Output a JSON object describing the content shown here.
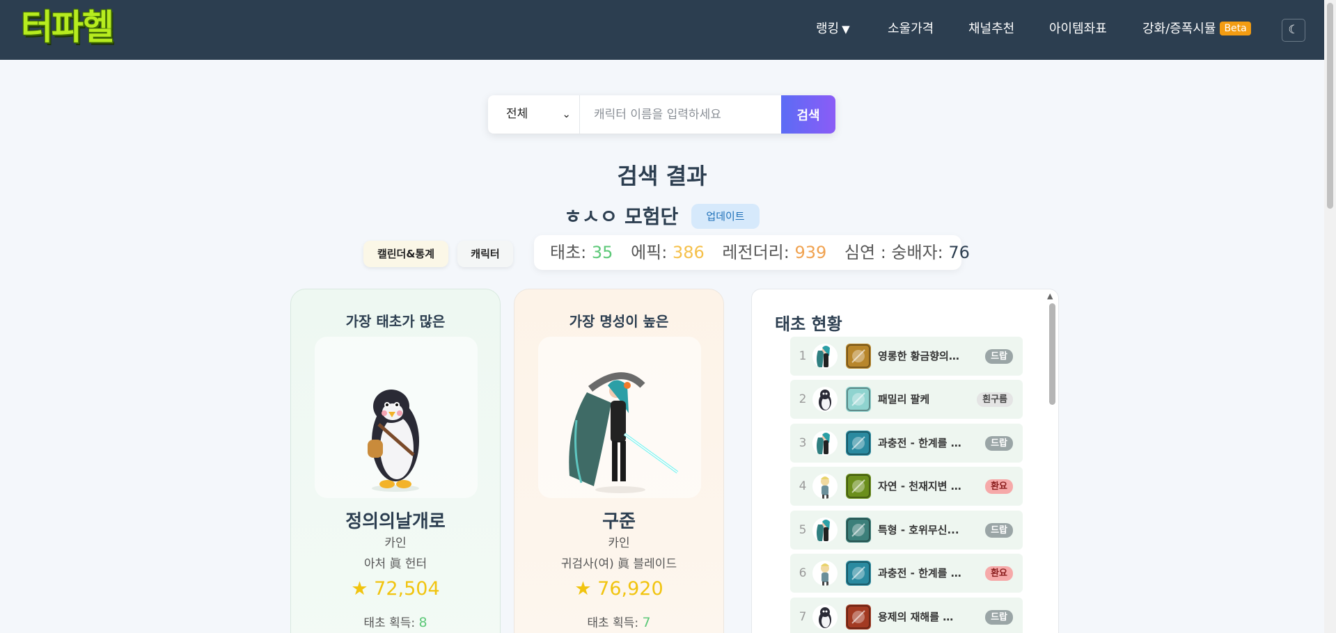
{
  "header": {
    "logo_text": "터파헬",
    "nav": [
      {
        "label": "랭킹",
        "has_caret": true
      },
      {
        "label": "소울가격"
      },
      {
        "label": "채널추천"
      },
      {
        "label": "아이템좌표"
      },
      {
        "label": "강화/증폭시뮬",
        "badge": "Beta"
      }
    ],
    "caret_icon": "▼",
    "theme_toggle_icon": "☾"
  },
  "search": {
    "select_value": "전체",
    "placeholder": "캐릭터 이름을 입력하세요",
    "button_label": "검색"
  },
  "results": {
    "title": "검색 결과",
    "guild_name": "ㅎㅅㅇ 모험단",
    "update_label": "업데이트",
    "tabs": [
      "캘린더&통계",
      "캐릭터"
    ],
    "stats": {
      "taecho_label": "태초:",
      "taecho_value": "35",
      "epic_label": "에픽:",
      "epic_value": "386",
      "legendary_label": "레전더리:",
      "legendary_value": "939",
      "abyss_label": "심연 : 숭배자:",
      "abyss_value": "76"
    }
  },
  "cards": [
    {
      "title": "가장 태초가 많은",
      "name": "정의의날개로",
      "server": "카인",
      "class": "아처 眞 헌터",
      "fame": "★ 72,504",
      "taecho_label": "태초 획득: ",
      "taecho_value": "8"
    },
    {
      "title": "가장 명성이 높은",
      "name": "구준",
      "server": "카인",
      "class": "귀검사(여) 眞 블레이드",
      "fame": "★ 76,920",
      "taecho_label": "태초 획득: ",
      "taecho_value": "7"
    }
  ],
  "taecho_panel": {
    "title": "태초 현황",
    "rows": [
      {
        "num": "1",
        "label": "영롱한 황금향의 ...",
        "badge": "드랍",
        "badge_type": "drop",
        "avatar": "blade",
        "item_color": "#b8862b"
      },
      {
        "num": "2",
        "label": "패밀리 팔케",
        "badge": "흰구름",
        "badge_type": "cloud",
        "avatar": "penguin",
        "item_color": "#8fd3cf"
      },
      {
        "num": "3",
        "label": "과충전 - 한계를 ...",
        "badge": "드랍",
        "badge_type": "drop",
        "avatar": "blade",
        "item_color": "#2a8aa0"
      },
      {
        "num": "4",
        "label": "자연 - 천재지변 ...",
        "badge": "환요",
        "badge_type": "yo",
        "avatar": "gunner",
        "item_color": "#6b8f1c"
      },
      {
        "num": "5",
        "label": "특형 - 호위무신...",
        "badge": "드랍",
        "badge_type": "drop",
        "avatar": "blade",
        "item_color": "#3c7f7a"
      },
      {
        "num": "6",
        "label": "과충전 - 한계를 ...",
        "badge": "환요",
        "badge_type": "yo",
        "avatar": "gunner",
        "item_color": "#2a8aa0"
      },
      {
        "num": "7",
        "label": "용제의 재해를 막...",
        "badge": "드랍",
        "badge_type": "drop",
        "avatar": "penguin",
        "item_color": "#a33a22"
      }
    ]
  }
}
